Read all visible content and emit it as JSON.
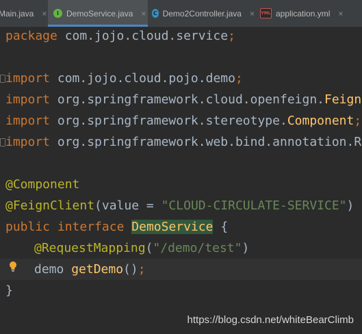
{
  "tabs": [
    {
      "label": "Main.java",
      "icon": "class-file-icon",
      "active": false
    },
    {
      "label": "DemoService.java",
      "icon": "interface-file-icon",
      "active": true
    },
    {
      "label": "Demo2Controller.java",
      "icon": "class-file-icon",
      "active": false
    },
    {
      "label": "application.yml",
      "icon": "yml-file-icon",
      "active": false
    }
  ],
  "tab_close_glyph": "×",
  "tab_icon_letters": {
    "interface": "I",
    "class": "C",
    "yml": "YML"
  },
  "code": {
    "package_kw": "package",
    "package_name": " com.jojo.cloud.service",
    "semicolon": ";",
    "import_kw": "import",
    "import_1": " com.jojo.cloud.pojo.demo",
    "import_2_pre": " org.springframework.cloud.openfeign.",
    "import_2_cls": "Feign",
    "import_3_pre": " org.springframework.stereotype.",
    "import_3_cls": "Component",
    "import_4": " org.springframework.web.bind.annotation.R",
    "ann_component": "@Component",
    "ann_feign": "@FeignClient",
    "feign_open": "(value = ",
    "feign_value": "\"CLOUD-CIRCULATE-SERVICE\"",
    "feign_close": ")",
    "public_kw": "public",
    "interface_kw": "interface",
    "class_name": "DemoService",
    "brace_open": " {",
    "ann_request": "@RequestMapping",
    "paren_open": "(",
    "mapping_value": "\"/demo/test\"",
    "paren_close": ")",
    "return_type": "demo ",
    "method_name": "getDemo",
    "method_parens": "()",
    "brace_close": "}"
  },
  "watermark": "https://blog.csdn.net/whiteBearClimb",
  "colors": {
    "background": "#2b2b2b",
    "keyword": "#cc7832",
    "annotation": "#bbb529",
    "string": "#6a8759",
    "method": "#ffc66d",
    "tab_active_underline": "#4a88c7"
  }
}
